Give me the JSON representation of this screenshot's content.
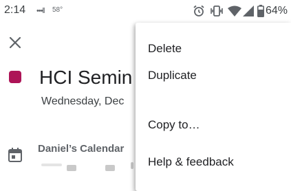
{
  "status_bar": {
    "time": "2:14",
    "signal_text": "•••ll",
    "temperature": "58°",
    "battery_percent": "64%",
    "icons": [
      "alarm-icon",
      "vibrate-icon",
      "wifi-icon",
      "cell-signal-icon",
      "battery-icon"
    ]
  },
  "event": {
    "title": "HCI Semin",
    "date": "Wednesday, Dec",
    "calendar": "Daniel’s Calendar",
    "color": "#ad1457"
  },
  "menu": {
    "items": [
      {
        "label": "Delete"
      },
      {
        "label": "Duplicate"
      },
      {
        "label": "Copy to…"
      },
      {
        "label": "Help & feedback"
      }
    ]
  }
}
